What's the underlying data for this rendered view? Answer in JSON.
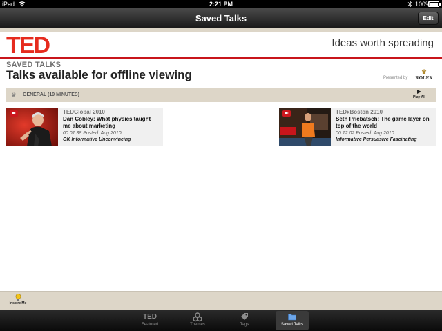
{
  "status": {
    "carrier": "iPad",
    "time": "2:21 PM",
    "battery": "100%"
  },
  "nav": {
    "title": "Saved Talks",
    "edit_label": "Edit"
  },
  "header": {
    "logo": "TED",
    "tagline": "Ideas worth spreading",
    "section": "SAVED TALKS",
    "title": "Talks available for offline viewing",
    "presented_by": "Presented by",
    "sponsor": "ROLEX"
  },
  "group": {
    "label": "GENERAL (19 MINUTES)",
    "play_all": "Play All"
  },
  "talks": [
    {
      "event": "TEDGlobal 2010",
      "title": "Dan Cobley: What physics taught me about marketing",
      "meta": "00:07:38 Posted: Aug 2010",
      "ratings": "OK Informative Unconvincing"
    },
    {
      "event": "TEDxBoston 2010",
      "title": "Seth Priebatsch: The game layer on top of the world",
      "meta": "00:12:02 Posted: Aug 2010",
      "ratings": "Informative Persuasive Fascinating"
    }
  ],
  "inspire": {
    "label": "Inspire Me"
  },
  "tabs": [
    {
      "label": "Featured",
      "icon": "ted-icon",
      "icon_text": "TED"
    },
    {
      "label": "Themes",
      "icon": "themes-icon"
    },
    {
      "label": "Tags",
      "icon": "tag-icon"
    },
    {
      "label": "Saved Talks",
      "icon": "folder-icon",
      "active": true
    }
  ],
  "colors": {
    "ted_red": "#e62b1e",
    "accent_bar": "#ddd6c8",
    "red_rule": "#c8151b"
  }
}
